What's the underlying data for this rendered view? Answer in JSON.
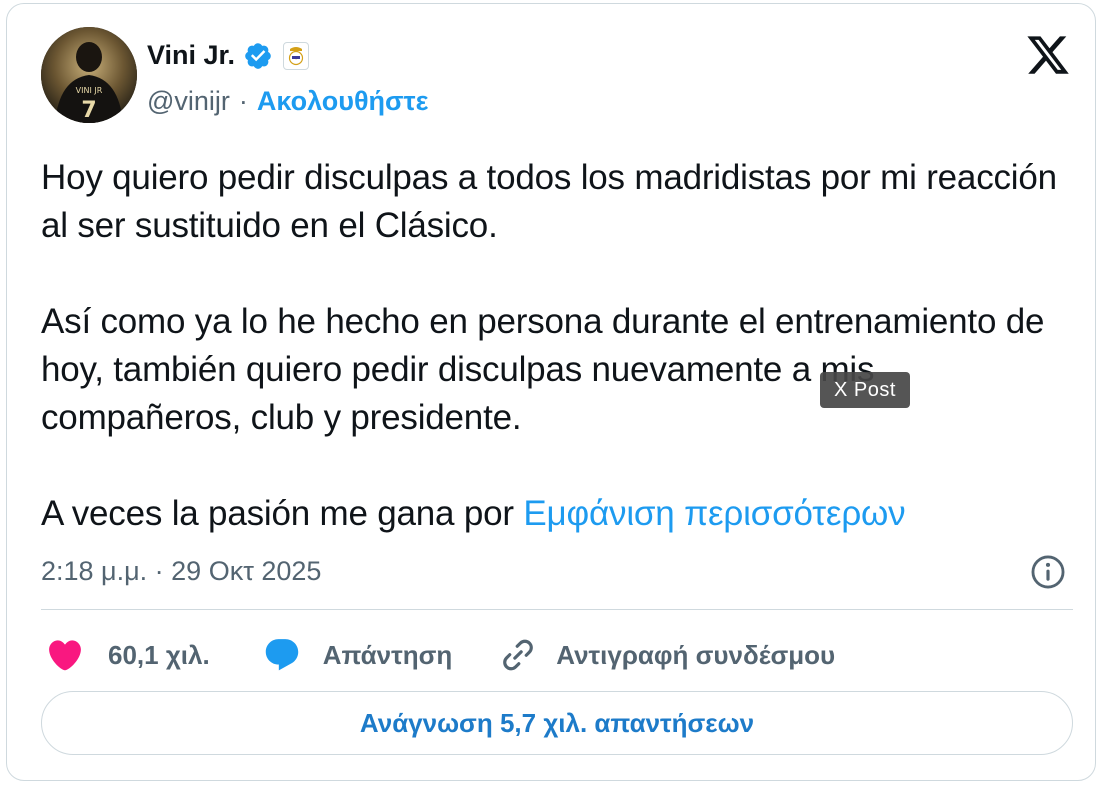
{
  "author": {
    "name": "Vini Jr.",
    "handle": "@vinijr",
    "follow_label": "Ακολουθήστε",
    "separator": "·",
    "avatar_icon": "player-photo-avatar",
    "verified_icon": "verified-badge-icon",
    "affiliation_icon": "real-madrid-crest-icon",
    "avatar_jersey": {
      "name": "VINI JR",
      "number": "7"
    }
  },
  "post": {
    "paragraphs": [
      "Hoy quiero pedir disculpas a todos los madridistas por mi reacción al ser sustituido en el Clásico.",
      "Así como ya lo he hecho en persona durante el entrenamiento de hoy, también quiero pedir disculpas nuevamente a mis compañeros, club y presidente."
    ],
    "last_paragraph_text": "A veces la pasión me gana por ",
    "show_more_label": "Εμφάνιση περισσότερων",
    "timestamp": "2:18 μ.μ. · 29 Οκτ 2025"
  },
  "tooltip": {
    "label": "X Post"
  },
  "actions": {
    "like_count": "60,1 χιλ.",
    "reply_label": "Απάντηση",
    "copy_link_label": "Αντιγραφή συνδέσμου"
  },
  "read_replies_label": "Ανάγνωση 5,7 χιλ. απαντήσεων",
  "colors": {
    "accent": "#1d9bf0",
    "heart": "#f91880",
    "text": "#0f1419",
    "muted": "#536471",
    "border": "#cfd9de"
  }
}
